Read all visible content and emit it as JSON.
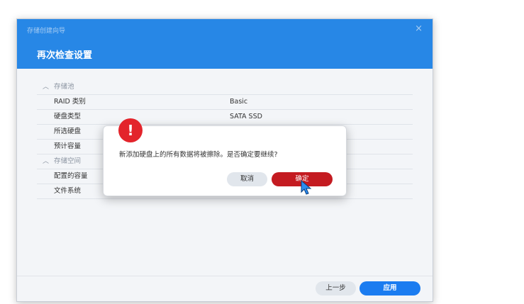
{
  "wizard": {
    "title": "存储创建向导",
    "step_title": "再次检查设置",
    "close_glyph": "×"
  },
  "summary": {
    "pool_section": "存储池",
    "rows_pool": [
      {
        "label": "RAID 类别",
        "value": "Basic"
      },
      {
        "label": "硬盘类型",
        "value": "SATA SSD"
      },
      {
        "label": "所选硬盘",
        "value": ""
      },
      {
        "label": "预计容量",
        "value": ""
      }
    ],
    "volume_section": "存储空间",
    "rows_volume": [
      {
        "label": "配置的容量",
        "value": ""
      },
      {
        "label": "文件系统",
        "value": ""
      }
    ]
  },
  "footer": {
    "prev_label": "上一步",
    "apply_label": "应用"
  },
  "confirm": {
    "icon_glyph": "!",
    "message": "新添加硬盘上的所有数据将被擦除。是否确定要继续?",
    "cancel_label": "取消",
    "ok_label": "确定"
  },
  "colors": {
    "header_blue": "#2787e6",
    "primary_blue": "#1b7cf0",
    "danger_red": "#c41b21",
    "warning_red": "#e3242b"
  },
  "icons": {
    "close": "close-icon",
    "chevron": "chevron-up-icon",
    "warning": "exclamation-icon",
    "cursor": "mouse-pointer-icon"
  }
}
